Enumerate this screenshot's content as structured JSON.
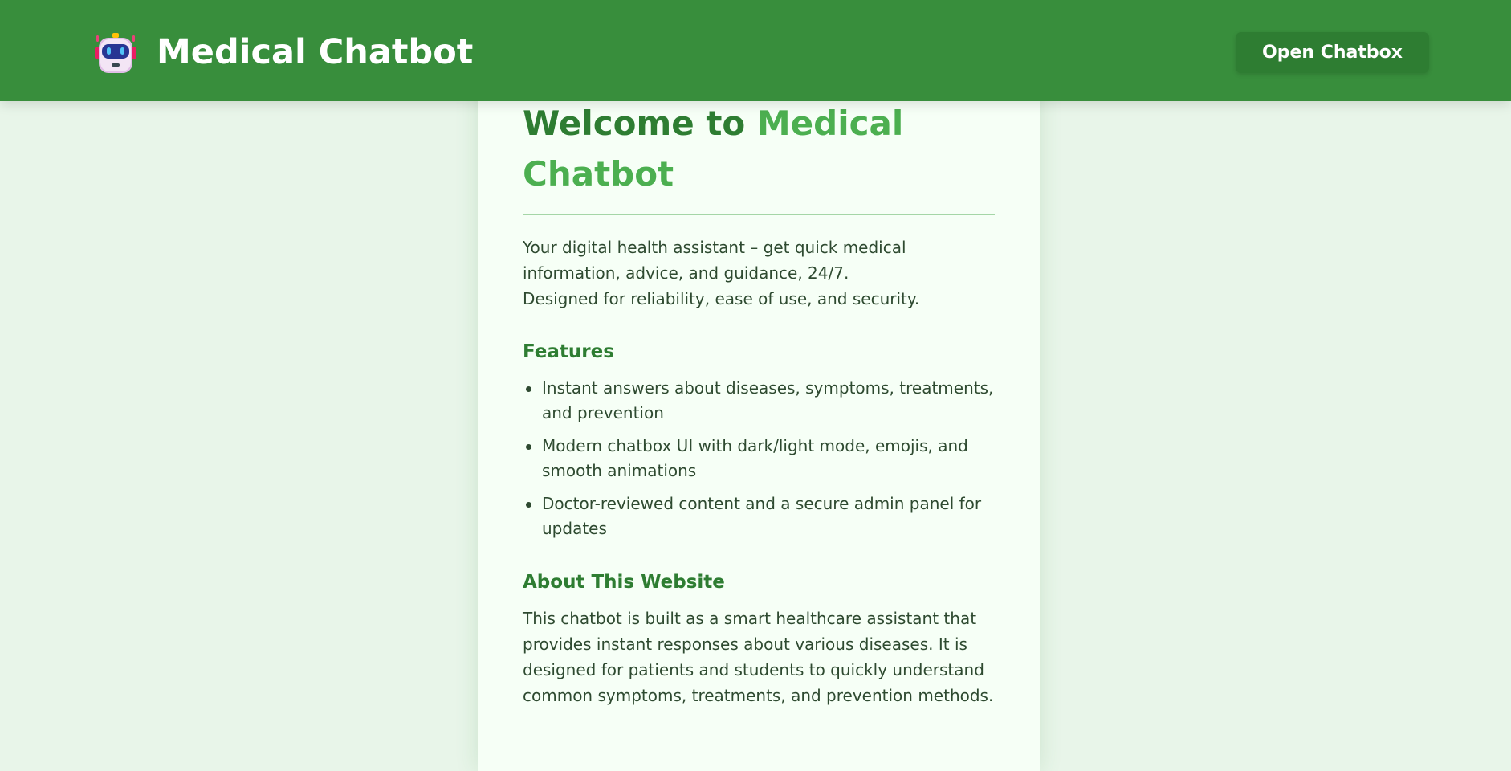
{
  "header": {
    "title": "Medical Chatbot",
    "logo_icon": "robot-icon",
    "open_button_label": "Open Chatbox"
  },
  "colors": {
    "header_bg": "#388e3c",
    "page_bg": "#e8f5e9",
    "accent": "#4caf50",
    "heading": "#2e7d32"
  },
  "main": {
    "welcome_prefix": "Welcome to ",
    "welcome_highlight": "Medical Chatbot",
    "intro_line1": "Your digital health assistant – get quick medical",
    "intro_line2": "information, advice, and guidance, 24/7.",
    "intro_line3": "Designed for reliability, ease of use, and security.",
    "features_heading": "Features",
    "features": [
      "Instant answers about diseases, symptoms, treatments, and prevention",
      "Modern chatbox UI with dark/light mode, emojis, and smooth animations",
      "Doctor-reviewed content and a secure admin panel for updates"
    ],
    "about_heading": "About This Website",
    "about_text": "This chatbot is built as a smart healthcare assistant that provides instant responses about various diseases. It is designed for patients and students to quickly understand common symptoms, treatments, and prevention methods."
  }
}
